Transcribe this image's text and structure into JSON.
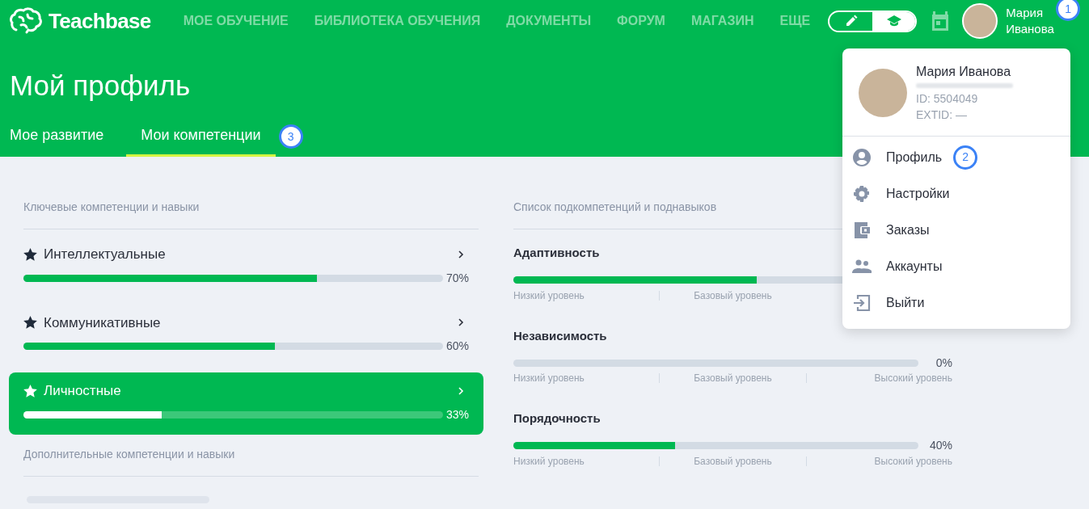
{
  "header": {
    "logo": "Teachbase",
    "nav": [
      {
        "label": "МОЕ ОБУЧЕНИЕ"
      },
      {
        "label": "БИБЛИОТЕКА ОБУЧЕНИЯ"
      },
      {
        "label": "ДОКУМЕНТЫ"
      },
      {
        "label": "ФОРУМ"
      },
      {
        "label": "МАГАЗИН"
      },
      {
        "label": "ЕЩЕ"
      }
    ],
    "mode_toggle": [
      {
        "kind": "edit",
        "selected": false
      },
      {
        "kind": "learn",
        "selected": true
      }
    ],
    "user": {
      "name": "Мария Иванова",
      "callout": "1"
    }
  },
  "page_title": "Мой профиль",
  "tabs": [
    {
      "label": "Мое развитие",
      "selected": false
    },
    {
      "label": "Мои компетенции",
      "selected": true,
      "callout": "3"
    }
  ],
  "competencies": {
    "title": "Ключевые компетенции и навыки",
    "items": [
      {
        "name": "Интеллектуальные",
        "level": 0.7,
        "reading": "70%",
        "selected": false
      },
      {
        "name": "Коммуникативные",
        "level": 0.6,
        "reading": "60%",
        "selected": false
      },
      {
        "name": "Личностные",
        "level": 0.33,
        "reading": "33%",
        "selected": true
      }
    ],
    "extra_title": "Дополнительные компетенции и навыки"
  },
  "subcompetencies": {
    "title": "Список подкомпетенций и поднавыков",
    "items": [
      {
        "name": "Адаптивность",
        "level": 0.6,
        "scale": [
          "Низкий уровень",
          "Базовый уровень"
        ]
      },
      {
        "name": "Независимость",
        "level": 0,
        "reading": "0%",
        "scale": [
          "Низкий уровень",
          "Базовый уровень",
          "Высокий уровень"
        ]
      },
      {
        "name": "Порядочность",
        "level": 0.4,
        "reading": "40%",
        "scale": [
          "Низкий уровень",
          "Базовый уровень",
          "Высокий уровень"
        ]
      }
    ]
  },
  "user_menu": {
    "name": "Мария Иванова",
    "id": "ID: 5504049",
    "extid": "EXTID: —",
    "items": [
      {
        "kind": "profile",
        "label": "Профиль",
        "callout": "2"
      },
      {
        "kind": "settings",
        "label": "Настройки"
      },
      {
        "kind": "orders",
        "label": "Заказы"
      },
      {
        "kind": "accounts",
        "label": "Аккаунты"
      },
      {
        "kind": "logout",
        "label": "Выйти"
      }
    ]
  }
}
